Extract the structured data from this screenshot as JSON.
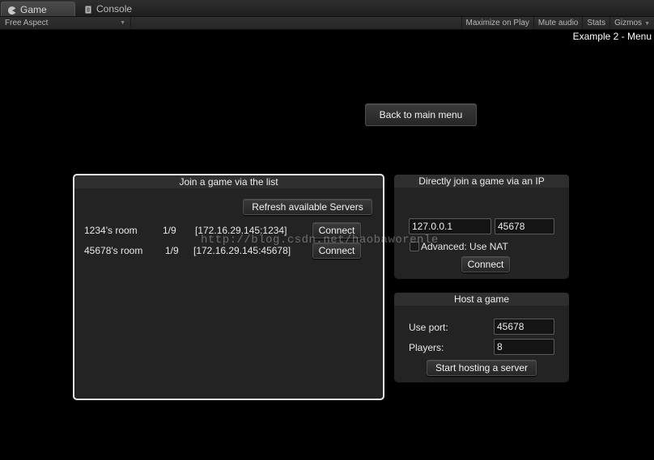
{
  "editor": {
    "tabs": [
      {
        "label": "Game",
        "icon": "pacman-icon"
      },
      {
        "label": "Console",
        "icon": "console-icon"
      }
    ],
    "aspect": "Free Aspect",
    "toolbar": [
      "Maximize on Play",
      "Mute audio",
      "Stats",
      "Gizmos"
    ]
  },
  "game": {
    "scene_title": "Example 2 - Menu",
    "back_button": "Back to main menu",
    "join_list": {
      "title": "Join a game via the list",
      "refresh_button": "Refresh available Servers",
      "rooms": [
        {
          "name": "1234's room",
          "players": "1/9",
          "address": "[172.16.29.145:1234]",
          "button": "Connect"
        },
        {
          "name": "45678's room",
          "players": "1/9",
          "address": "[172.16.29.145:45678]",
          "button": "Connect"
        }
      ]
    },
    "direct_join": {
      "title": "Directly join a game via an IP",
      "ip_value": "127.0.0.1",
      "port_value": "45678",
      "nat_label": "Advanced: Use NAT",
      "connect_button": "Connect"
    },
    "host": {
      "title": "Host a game",
      "port_label": "Use port:",
      "port_value": "45678",
      "players_label": "Players:",
      "players_value": "8",
      "start_button": "Start hosting a server"
    },
    "watermark": "http://blog.csdn.net/haobaworenle"
  }
}
